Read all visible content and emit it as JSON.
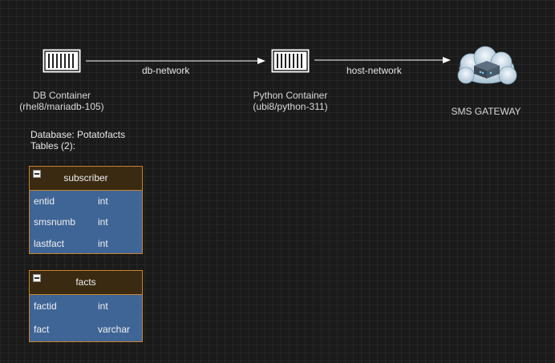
{
  "nodes": {
    "db_container": {
      "name": "DB Container",
      "image": "(rhel8/mariadb-105)"
    },
    "python_container": {
      "name": "Python Container",
      "image": "(ubi8/python-311)"
    },
    "sms_gateway": {
      "name": "SMS GATEWAY"
    }
  },
  "edges": {
    "db_network": "db-network",
    "host_network": "host-network"
  },
  "database": {
    "title": "Database: Potatofacts",
    "tables_label": "Tables (2):"
  },
  "tables": [
    {
      "name": "subscriber",
      "fields": [
        {
          "name": "entid",
          "type": "int"
        },
        {
          "name": "smsnumb",
          "type": "int"
        },
        {
          "name": "lastfact",
          "type": "int"
        }
      ]
    },
    {
      "name": "facts",
      "fields": [
        {
          "name": "factid",
          "type": "int"
        },
        {
          "name": "fact",
          "type": "varchar"
        }
      ]
    }
  ],
  "colors": {
    "background": "#1a1a1a",
    "table_border": "#c8822e",
    "table_header": "#3a2a12",
    "table_body": "#3f6596",
    "arrow": "#ffffff"
  }
}
